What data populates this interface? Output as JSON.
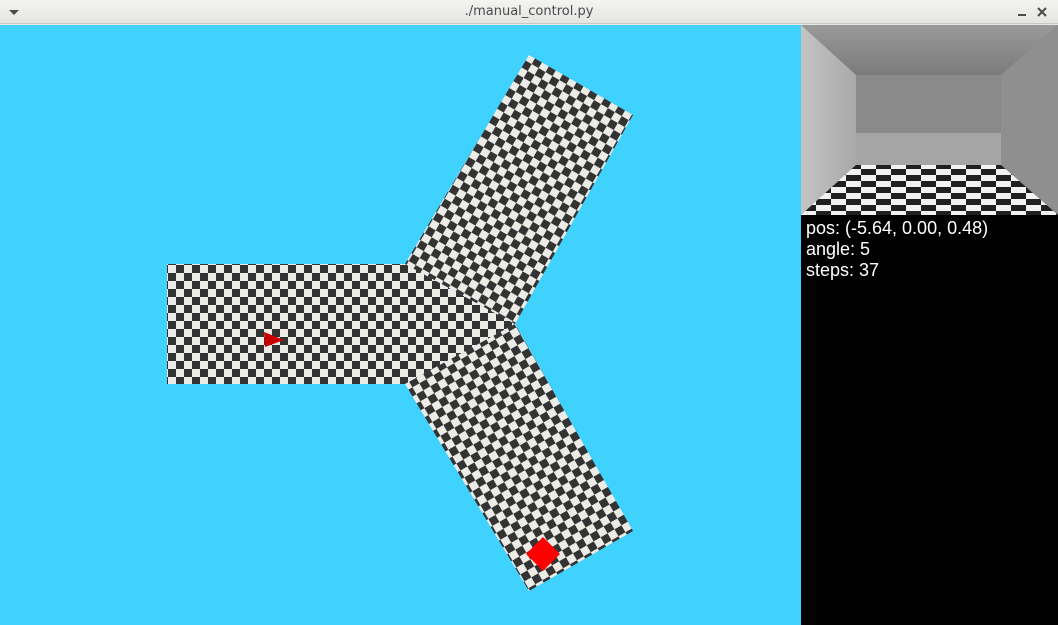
{
  "window": {
    "title": "./manual_control.py"
  },
  "titlebar_icons": {
    "menu": "chevron-down-icon",
    "minimize": "minimize-icon",
    "close": "close-icon"
  },
  "colors": {
    "sky": "#3fd2ff",
    "checker_dark": "#333333",
    "checker_light": "#ecebe6",
    "agent": "#c80000",
    "goal_box": "#ff0000",
    "panel_bg": "#000000",
    "panel_text": "#ffffff"
  },
  "scene": {
    "floor_pattern": "checkerboard",
    "map": "three-way junction",
    "agent_marker": "red-triangle",
    "goal_object": "red-box"
  },
  "status": {
    "pos": "pos: (-5.64, 0.00, 0.48)",
    "angle": "angle: 5",
    "steps": "steps: 37"
  }
}
